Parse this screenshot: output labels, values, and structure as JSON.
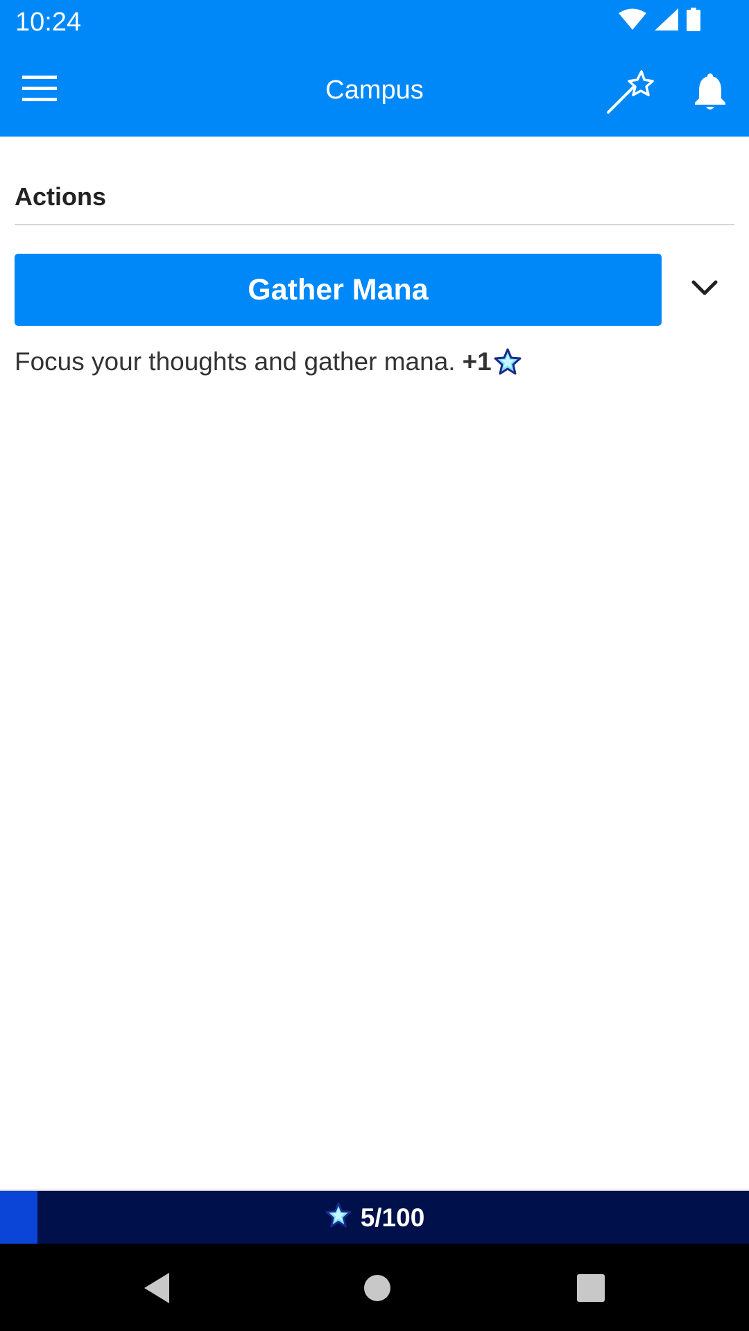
{
  "status_bar": {
    "time": "10:24",
    "icons": [
      "wifi-icon",
      "cellular-signal-icon",
      "battery-icon"
    ]
  },
  "app_bar": {
    "title": "Campus",
    "menu_icon": "hamburger-menu-icon",
    "actions": [
      "magic-wand-icon",
      "notification-bell-icon"
    ]
  },
  "actions_section": {
    "title": "Actions",
    "items": [
      {
        "label": "Gather Mana",
        "description": "Focus your thoughts and gather mana.",
        "reward": "+1",
        "reward_icon": "mana-star-icon",
        "expand_icon": "chevron-down-icon"
      }
    ]
  },
  "resource_bar": {
    "icon": "mana-star-icon",
    "value_text": "5/100",
    "fill_fraction": 0.05
  },
  "nav_bar": {
    "buttons": [
      "back-icon",
      "home-icon",
      "recents-icon"
    ]
  },
  "colors": {
    "primary": "#0088f8",
    "resource_bg": "#00104a",
    "resource_fill": "#0a45d8",
    "nav_bg": "#000000"
  }
}
